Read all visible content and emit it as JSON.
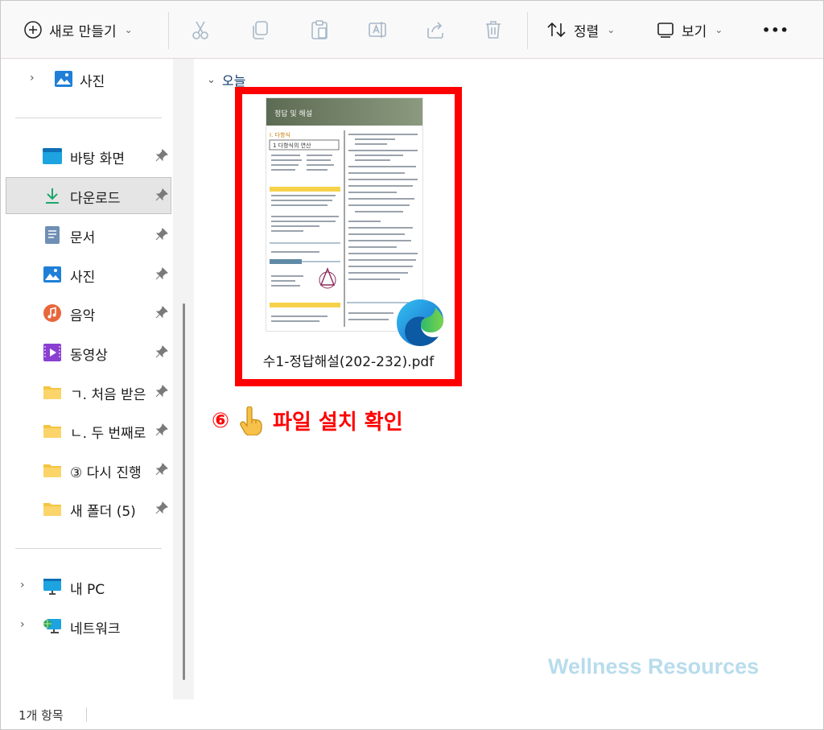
{
  "toolbar": {
    "new_label": "새로 만들기",
    "sort_label": "정렬",
    "view_label": "보기",
    "more_label": "•••"
  },
  "sidebar": {
    "top_item": "사진",
    "quick_access": [
      {
        "label": "바탕 화면",
        "icon": "desktop-icon"
      },
      {
        "label": "다운로드",
        "icon": "download-icon"
      },
      {
        "label": "문서",
        "icon": "document-icon"
      },
      {
        "label": "사진",
        "icon": "pictures-icon"
      },
      {
        "label": "음악",
        "icon": "music-icon"
      },
      {
        "label": "동영상",
        "icon": "video-icon"
      },
      {
        "label": "ㄱ. 처음 받은",
        "icon": "folder-icon"
      },
      {
        "label": "ㄴ. 두 번째로",
        "icon": "folder-icon"
      },
      {
        "label": "③ 다시 진행",
        "icon": "folder-icon"
      },
      {
        "label": "새 폴더 (5)",
        "icon": "folder-icon"
      }
    ],
    "this_pc": "내 PC",
    "network": "네트워크"
  },
  "content": {
    "group_header": "오늘",
    "file": {
      "name": "수1-정답해설(202-232).pdf",
      "thumb_header": "정답 및 해설",
      "thumb_section": "Ⅰ. 다항식",
      "thumb_subsection": "1 다항식의 연산"
    },
    "annotation": {
      "number": "⑥",
      "text": "파일 설치 확인"
    }
  },
  "status": {
    "item_count": "1개 항목"
  },
  "watermark": "Wellness Resources",
  "colors": {
    "highlight": "#ff0000",
    "accent": "#0078d4",
    "watermark": "#b8dcec"
  }
}
